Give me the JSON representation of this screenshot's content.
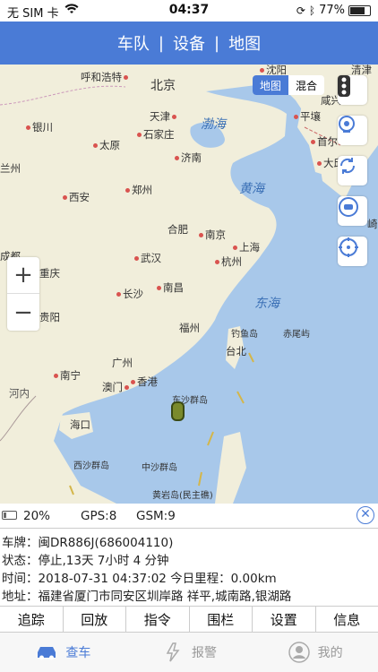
{
  "status_bar": {
    "carrier": "无 SIM 卡",
    "time": "04:37",
    "battery_percent": "77%",
    "battery_level": 0.77
  },
  "nav": {
    "items": [
      "车队",
      "设备",
      "地图"
    ],
    "separator": "|"
  },
  "map": {
    "type_toggle": {
      "map": "地图",
      "hybrid": "混合",
      "selected": "map"
    },
    "zoom_in": "+",
    "zoom_out": "−",
    "cities": {
      "hohhot": "呼和浩特",
      "beijing": "北京",
      "shenyang": "沈阳",
      "qingdao_top": "清津",
      "yinchuan": "银川",
      "tianjin": "天津",
      "shijiazhuang": "石家庄",
      "taiyuan": "太原",
      "pyongyang": "平壤",
      "xianjing": "咸兴",
      "seoul": "首尔",
      "lanzhou": "兰州",
      "jinan": "济南",
      "daegu": "大邱",
      "xian": "西安",
      "zhengzhou": "郑州",
      "hefei": "合肥",
      "nanjing": "南京",
      "shanghai": "上海",
      "chengdu": "成都",
      "wuhan": "武汉",
      "hangzhou": "杭州",
      "chongqing": "重庆",
      "changsha": "长沙",
      "nanchang": "南昌",
      "guiyang": "贵阳",
      "fuzhou": "福州",
      "guangzhou": "广州",
      "nanning": "南宁",
      "macau": "澳门",
      "hongkong": "香港",
      "taipei": "台北",
      "hanoi": "河内",
      "haikou": "海口",
      "nagasaki": "崎"
    },
    "seas": {
      "bohai": "渤海",
      "huanghai": "黄海",
      "donghai": "东海"
    },
    "islands": {
      "diaoyu": "钓鱼岛",
      "chiwei": "赤尾屿",
      "dongsha": "东沙群岛",
      "xisha": "西沙群岛",
      "zhongsha": "中沙群岛",
      "huangyan": "黄岩岛(民主礁)"
    },
    "icons": [
      "traffic-light-icon",
      "location-pin-icon",
      "refresh-icon",
      "car-icon",
      "target-icon"
    ]
  },
  "info": {
    "battery": "20%",
    "battery_level": 0.2,
    "gps": "GPS:8",
    "gsm": "GSM:9",
    "plate": "车牌：闽DR886J(686004110)",
    "status": "状态：停止,13天 7小时 4 分钟",
    "time": "时间：2018-07-31 04:37:02  今日里程：0.00km",
    "address": "地址：福建省厦门市同安区圳岸路 祥平,城南路,银湖路"
  },
  "actions": [
    "追踪",
    "回放",
    "指令",
    "围栏",
    "设置",
    "信息"
  ],
  "tabs": [
    {
      "label": "查车",
      "icon": "car-icon",
      "active": true
    },
    {
      "label": "报警",
      "icon": "alarm-icon",
      "active": false
    },
    {
      "label": "我的",
      "icon": "user-icon",
      "active": false
    }
  ],
  "colors": {
    "primary": "#4a7bd6",
    "sea": "#a8c8ea",
    "land": "#f1eedb"
  }
}
